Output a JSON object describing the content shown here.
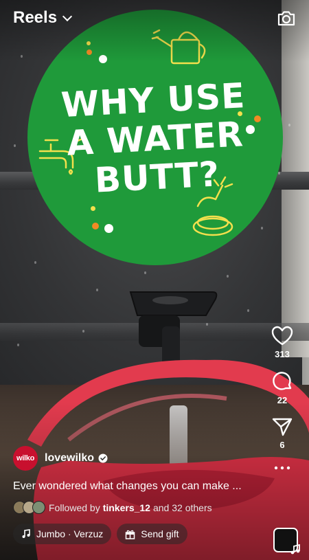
{
  "topbar": {
    "title": "Reels"
  },
  "video": {
    "circle_title": "WHY USE\nA WATER\nBUTT?",
    "colors": {
      "green": "#1f9a3a",
      "red": "#e8344a",
      "orange": "#f08a24",
      "yellow": "#f4e04d"
    }
  },
  "actions": {
    "likes": "313",
    "comments": "22",
    "shares": "6"
  },
  "post": {
    "avatar_text": "wilko",
    "username": "lovewilko",
    "caption": "Ever wondered what changes you can make ...",
    "followed_prefix": "Followed by",
    "followed_user": "tinkers_12",
    "followed_suffix": "and 32 others",
    "music_label": "Jumbo · Verzuz",
    "gift_label": "Send gift"
  }
}
